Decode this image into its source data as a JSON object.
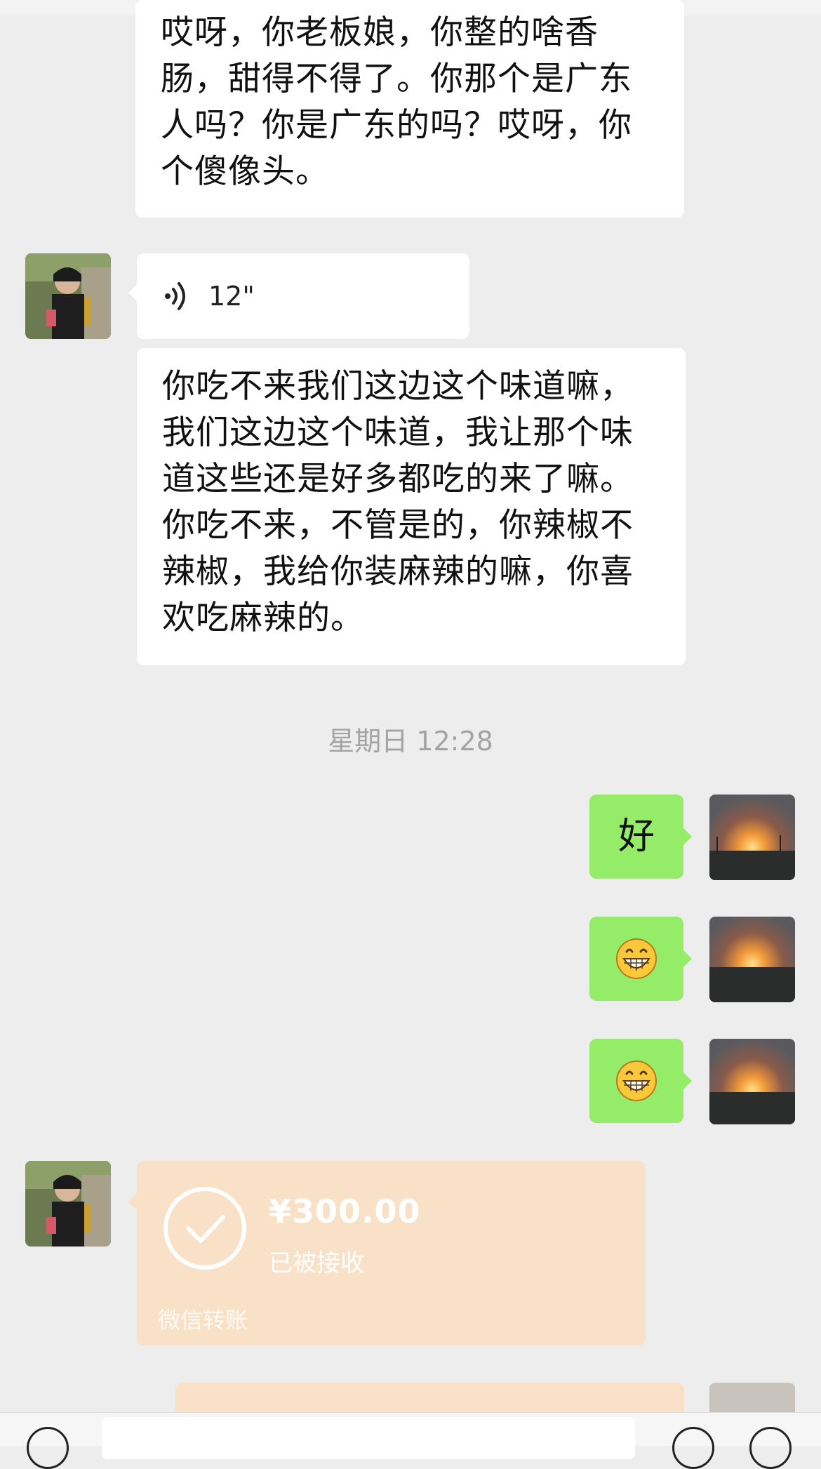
{
  "messages": {
    "received_1": {
      "text": "哎呀，你老板娘，你整的啥香\n肠，甜得不得了。你那个是广东\n人吗？你是广东的吗？哎呀，你\n个傻像头。"
    },
    "voice": {
      "duration": "12\"",
      "icon": "voice-wave-icon"
    },
    "received_2": {
      "text": "你吃不来我们这边这个味道嘛，\n我们这边这个味道，我让那个味\n道这些还是好多都吃的来了嘛。\n你吃不来，不管是的，你辣椒不\n辣椒，我给你装麻辣的嘛，你喜\n欢吃麻辣的。"
    },
    "timestamp": "星期日 12:28",
    "sent_1": {
      "text": "好"
    },
    "sent_2": {
      "emoji": "grinning-face-emoji"
    },
    "sent_3": {
      "emoji": "grinning-face-emoji"
    },
    "transfer": {
      "amount": "¥300.00",
      "status": "已被接收",
      "brand": "微信转账"
    }
  },
  "colors": {
    "background": "#ededed",
    "received_bubble": "#ffffff",
    "sent_bubble": "#95ec69",
    "transfer_card": "#f8e1c7",
    "timestamp_text": "#a3a3a3"
  }
}
